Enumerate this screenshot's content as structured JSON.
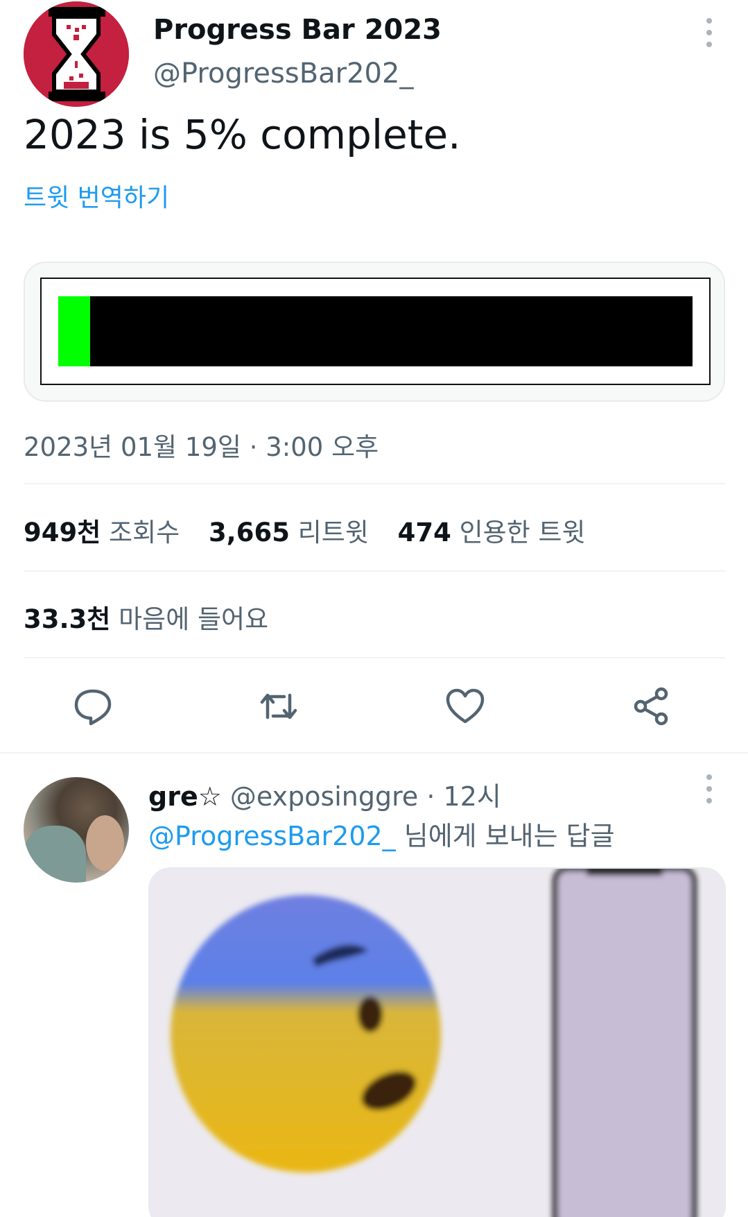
{
  "tweet": {
    "display_name": "Progress Bar 2023",
    "handle": "@ProgressBar202_",
    "text": "2023 is 5% complete.",
    "translate_label": "트윗 번역하기",
    "progress_fraction": 0.05,
    "progress_color": "#00ff00",
    "avatar_color": "#c4203f",
    "timestamp": "2023년 01월 19일 · 3:00 오후",
    "stats": {
      "views_num": "949천",
      "views_label": "조회수",
      "retweets_num": "3,665",
      "retweets_label": "리트윗",
      "quotes_num": "474",
      "quotes_label": "인용한 트윗",
      "likes_num": "33.3천",
      "likes_label": "마음에 들어요"
    },
    "actions": [
      "reply-icon",
      "retweet-icon",
      "like-icon",
      "share-icon"
    ]
  },
  "reply": {
    "display_name": "gre☆",
    "handle": "@exposinggre",
    "time": "· 12시",
    "mention": "@ProgressBar202_",
    "reply_to_suffix": " 님에게 보내는 답글"
  },
  "colors": {
    "accent": "#1d9bf0",
    "secondary_text": "#536471"
  }
}
